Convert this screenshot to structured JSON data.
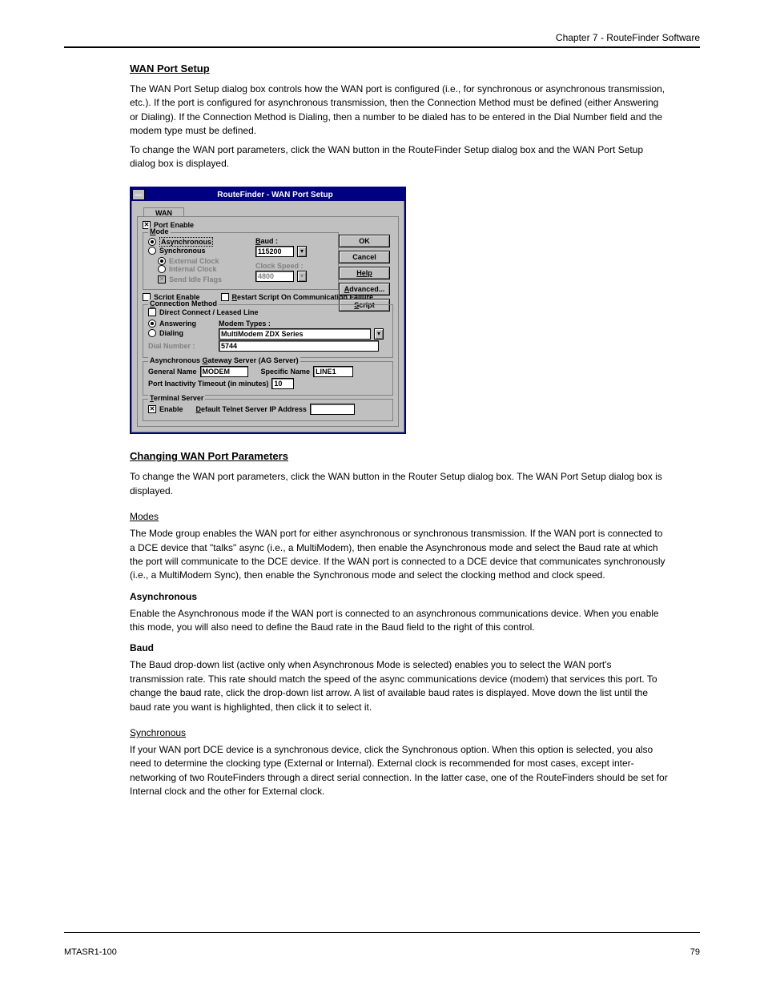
{
  "page": {
    "header_left": "Chapter 7 - RouteFinder Software",
    "footer_left": "MTASR1-100",
    "footer_right": "79"
  },
  "doc": {
    "title1": "WAN Port Setup",
    "para1a": "The WAN Port Setup dialog box controls how the WAN port is configured (i.e., for synchronous or asynchronous transmission, etc.). If the port is configured for asynchronous transmission, then the Connection Method must be defined (either Answering or Dialing). If the Connection Method is Dialing, then a number to be dialed has to be entered in the Dial Number field and the modem type must be defined.",
    "para1b": "To change the WAN port parameters, click the WAN button in the RouteFinder Setup dialog box and the WAN Port Setup dialog box is displayed.",
    "title2": "Changing WAN Port Parameters",
    "para2": "To change the WAN port parameters, click the WAN button in the Router Setup dialog box. The WAN Port Setup dialog box is displayed.",
    "mode_heading": "Modes",
    "mode_para": "The Mode group enables the WAN port for either asynchronous or synchronous transmission. If the WAN port is connected to a DCE device that \"talks\" async (i.e., a MultiModem), then enable the Asynchronous mode and select the Baud rate at which the port will communicate to the DCE device. If the WAN port is connected to a DCE device that communicates synchronously (i.e., a MultiModem Sync), then enable the Synchronous mode and select the clocking method and clock speed.",
    "async_heading": "Asynchronous",
    "async_para": "Enable the Asynchronous mode if the WAN port is connected to an asynchronous communications device. When you enable this mode, you will also need to define the Baud rate in the Baud field to the right of this control.",
    "baud_heading": "Baud",
    "baud_para": "The Baud drop-down list (active only when Asynchronous Mode is selected) enables you to select the WAN port's transmission rate. This rate should match the speed of the async communications device (modem) that services this port. To change the baud rate, click the drop-down list arrow. A list of available baud rates is displayed. Move down the list until the baud rate you want is highlighted, then click it to select it.",
    "sync_heading": "Synchronous",
    "sync_para": "If your WAN port DCE device is a synchronous device, click the Synchronous option. When this option is selected, you also need to determine the clocking type (External or Internal). External clock is recommended for most cases, except inter-networking of two RouteFinders through a direct serial connection. In the latter case, one of the RouteFinders should be set for Internal clock and the other for External clock."
  },
  "dlg": {
    "title": "RouteFinder - WAN Port Setup",
    "tab": "WAN",
    "port_enable": "Port Enable",
    "mode_label": "Mode",
    "async": "Asynchronous",
    "sync": "Synchronous",
    "ext_clock": "External Clock",
    "int_clock": "Internal Clock",
    "idle_flags": "Send Idle Flags",
    "baud_label": "Baud :",
    "baud_value": "115200",
    "clock_label": "Clock Speed :",
    "clock_value": "4800",
    "btn_ok": "OK",
    "btn_cancel": "Cancel",
    "btn_help": "Help",
    "btn_advanced": "Advanced...",
    "btn_script": "Script",
    "script_enable_label": "Script Enable",
    "restart_label": "Restart Script On Communication Failure",
    "conn_label": "Connection Method",
    "direct": "Direct Connect / Leased Line",
    "answering": "Answering",
    "dialing": "Dialing",
    "modem_types_label": "Modem Types :",
    "modem_type_value": "MultiModem ZDX Series",
    "dial_label": "Dial Number :",
    "dial_value": "5744",
    "ag_label": "Asynchronous Gateway Server (AG Server)",
    "general_name_label": "General Name",
    "general_name_value": "MODEM",
    "specific_name_label": "Specific Name",
    "specific_name_value": "LINE1",
    "timeout_label": "Port Inactivity Timeout (in minutes)",
    "timeout_value": "10",
    "term_label": "Terminal Server",
    "enable_label": "Enable",
    "telnet_label": "Default Telnet Server IP Address"
  }
}
